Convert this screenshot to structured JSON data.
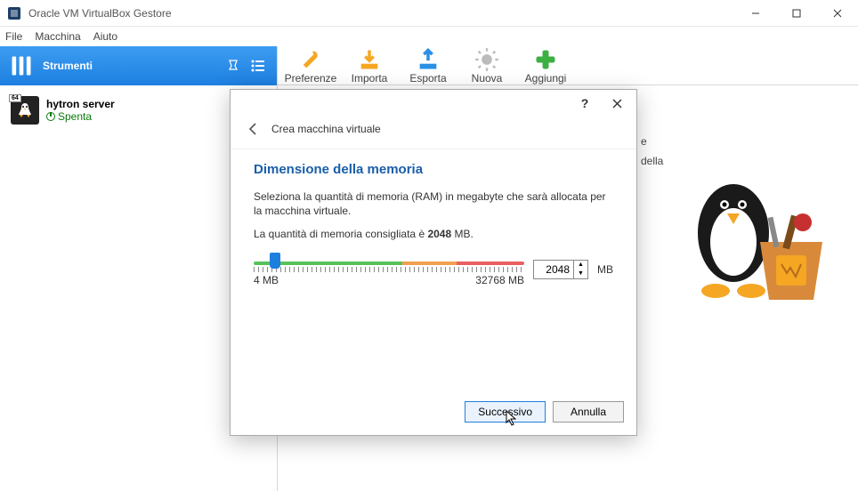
{
  "window": {
    "title": "Oracle VM VirtualBox Gestore"
  },
  "menu": {
    "file": "File",
    "machine": "Macchina",
    "help": "Aiuto"
  },
  "tools": {
    "label": "Strumenti",
    "toolbar": [
      {
        "key": "prefs",
        "label": "Preferenze"
      },
      {
        "key": "import",
        "label": "Importa"
      },
      {
        "key": "export",
        "label": "Esporta"
      },
      {
        "key": "new",
        "label": "Nuova"
      },
      {
        "key": "add",
        "label": "Aggiungi"
      }
    ]
  },
  "vm": {
    "name": "hytron server",
    "state": "Spenta",
    "badge": "64"
  },
  "dialog": {
    "wizard_title": "Crea macchina virtuale",
    "heading": "Dimensione della memoria",
    "desc": "Seleziona la quantità di memoria (RAM) in megabyte che sarà allocata per la macchina virtuale.",
    "recommended_pre": "La quantità di memoria consigliata è ",
    "recommended_val": "2048",
    "recommended_post": " MB.",
    "min_label": "4 MB",
    "max_label": "32768 MB",
    "value": "2048",
    "unit": "MB",
    "next": "Successivo",
    "cancel": "Annulla"
  },
  "welcome_snippets": {
    "a": "e",
    "b": "della"
  }
}
